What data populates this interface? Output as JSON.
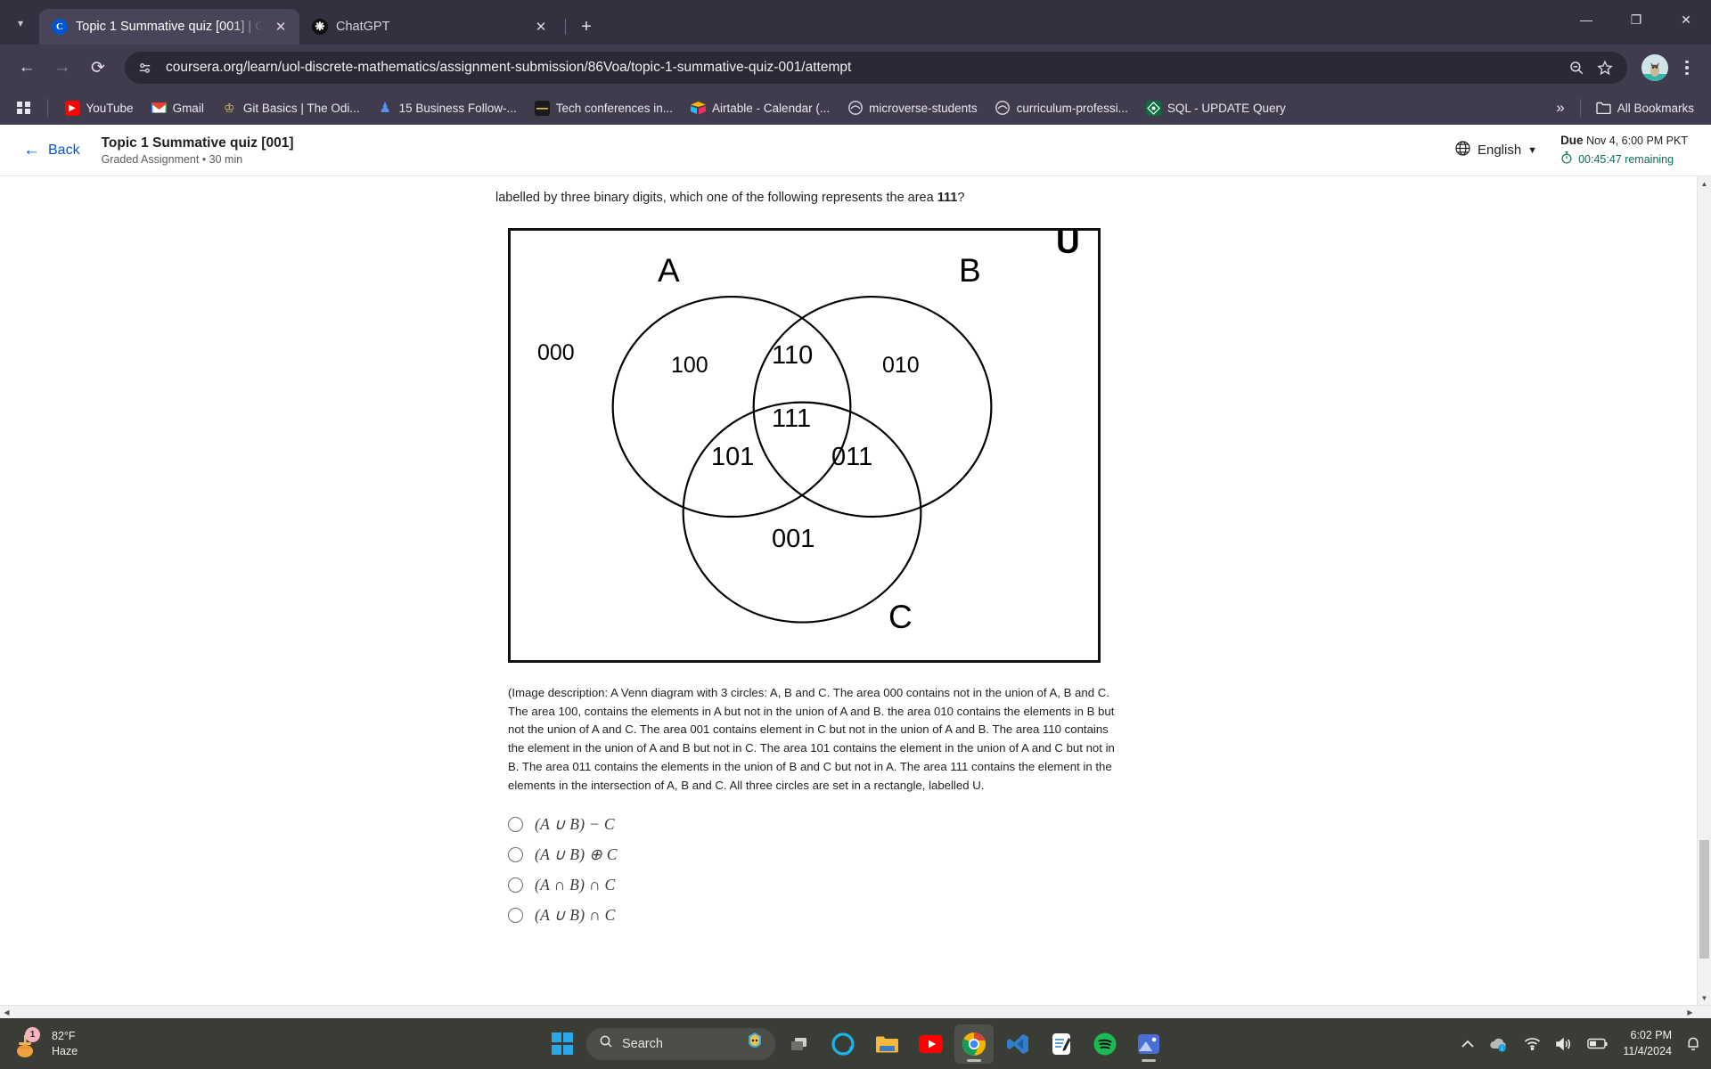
{
  "browser": {
    "tabs": [
      {
        "title": "Topic 1 Summative quiz [001] | C",
        "favicon": "coursera-icon",
        "active": true
      },
      {
        "title": "ChatGPT",
        "favicon": "chatgpt-icon",
        "active": false
      }
    ],
    "new_tab_label": "+",
    "window_controls": {
      "minimize": "—",
      "maximize": "❐",
      "close": "✕"
    },
    "nav": {
      "back": "←",
      "forward": "→",
      "reload": "⟳"
    },
    "omnibox": {
      "url": "coursera.org/learn/uol-discrete-mathematics/assignment-submission/86Voa/topic-1-summative-quiz-001/attempt",
      "site_icon": "site-settings-icon",
      "zoom_icon": "zoom-out-icon",
      "bookmark_icon": "star-icon"
    },
    "bookmarks": [
      {
        "label": "YouTube",
        "icon": "youtube-icon"
      },
      {
        "label": "Gmail",
        "icon": "gmail-icon"
      },
      {
        "label": "Git Basics | The Odi...",
        "icon": "odin-icon"
      },
      {
        "label": "15 Business Follow-...",
        "icon": "doc-icon"
      },
      {
        "label": "Tech conferences in...",
        "icon": "tech-icon"
      },
      {
        "label": "Airtable - Calendar (...",
        "icon": "airtable-icon"
      },
      {
        "label": "microverse-students",
        "icon": "microverse-icon"
      },
      {
        "label": "curriculum-professi...",
        "icon": "microverse-icon"
      },
      {
        "label": "SQL - UPDATE Query",
        "icon": "sql-icon"
      }
    ],
    "overflow_label": "»",
    "all_bookmarks_label": "All Bookmarks"
  },
  "coursera": {
    "back_label": "Back",
    "quiz_title": "Topic 1 Summative quiz [001]",
    "quiz_subtitle": "Graded Assignment • 30 min",
    "language": "English",
    "due_label": "Due",
    "due_value": "Nov 4, 6:00 PM PKT",
    "time_remaining": "00:45:47 remaining"
  },
  "question": {
    "text_before_bold": "labelled by three binary digits, which one of the following represents the area ",
    "bold_value": "111",
    "text_after_bold": "?",
    "image_description": "(Image description: A Venn diagram with 3 circles: A, B and C. The area 000 contains not in the union of A, B and C. The area 100, contains the elements in A but not in the union of A and B. the area 010 contains the elements in B but not the union of A and C. The area 001 contains element in C but not in the union of A and B. The area 110 contains the element in the union of A and B but not in C. The area 101 contains the element in the union of A and C but not in B. The area 011 contains the elements in the union of B and C but not in A. The area 111 contains the element in the elements in the intersection of A, B and C. All three circles are set in a rectangle, labelled U.",
    "options": [
      {
        "id": "opt1",
        "latex": "(A ∪ B) − C",
        "selected": false
      },
      {
        "id": "opt2",
        "latex": "(A ∪ B) ⊕ C",
        "selected": false
      },
      {
        "id": "opt3",
        "latex": "(A ∩ B) ∩ C",
        "selected": false
      },
      {
        "id": "opt4",
        "latex": "(A ∪ B) ∩ C",
        "selected": false
      }
    ]
  },
  "venn": {
    "universe_label": "U",
    "set_labels": {
      "a": "A",
      "b": "B",
      "c": "C"
    },
    "regions": [
      {
        "code": "000",
        "name": "outside-all"
      },
      {
        "code": "100",
        "name": "a-only"
      },
      {
        "code": "110",
        "name": "a-and-b"
      },
      {
        "code": "010",
        "name": "b-only"
      },
      {
        "code": "111",
        "name": "a-b-c"
      },
      {
        "code": "101",
        "name": "a-and-c"
      },
      {
        "code": "011",
        "name": "b-and-c"
      },
      {
        "code": "001",
        "name": "c-only"
      }
    ]
  },
  "scrollbar": {
    "up": "▲",
    "down": "▼",
    "left": "◀",
    "right": "▶"
  },
  "taskbar": {
    "weather_temp": "82°F",
    "weather_cond": "Haze",
    "weather_badge": "1",
    "search_placeholder": "Search",
    "apps": [
      {
        "name": "task-view-icon",
        "active": false
      },
      {
        "name": "alexa-icon",
        "active": false
      },
      {
        "name": "file-explorer-icon",
        "active": false
      },
      {
        "name": "youtube-icon",
        "active": false
      },
      {
        "name": "chrome-icon",
        "active": true
      },
      {
        "name": "vscode-icon",
        "active": false
      },
      {
        "name": "sticky-notes-icon",
        "active": false
      },
      {
        "name": "spotify-icon",
        "active": false
      },
      {
        "name": "photos-icon",
        "active": false
      }
    ],
    "time": "6:02 PM",
    "date": "11/4/2024"
  },
  "colors": {
    "chrome_bg": "#413b4e",
    "tabstrip_bg": "#35303f",
    "coursera_blue": "#0056d2",
    "timer_green": "#0b6b5a",
    "taskbar_bg": "#3a3d36"
  }
}
